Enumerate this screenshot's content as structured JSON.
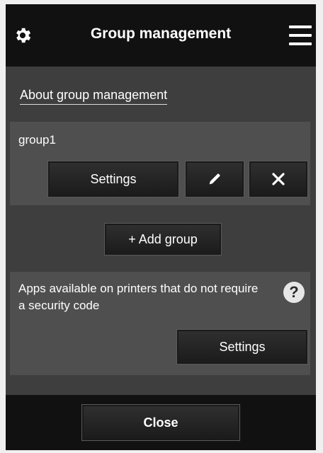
{
  "header": {
    "title": "Group management",
    "left_icon": "gear-icon",
    "right_icon": "hamburger-menu-icon"
  },
  "about_link": "About group management",
  "group": {
    "name": "group1",
    "settings_label": "Settings",
    "edit_icon": "pencil-icon",
    "delete_icon": "close-icon"
  },
  "add_group": {
    "icon": "plus-icon",
    "label": "+ Add group"
  },
  "apps": {
    "text": "Apps available on printers that do not require a security code",
    "help_label": "?",
    "settings_label": "Settings"
  },
  "footer": {
    "close_label": "Close"
  },
  "colors": {
    "header_bg": "#111111",
    "body_bg": "#3e3e3e",
    "card_bg": "#4f4f4f",
    "button_bg": "#222222",
    "text": "#ffffff"
  }
}
